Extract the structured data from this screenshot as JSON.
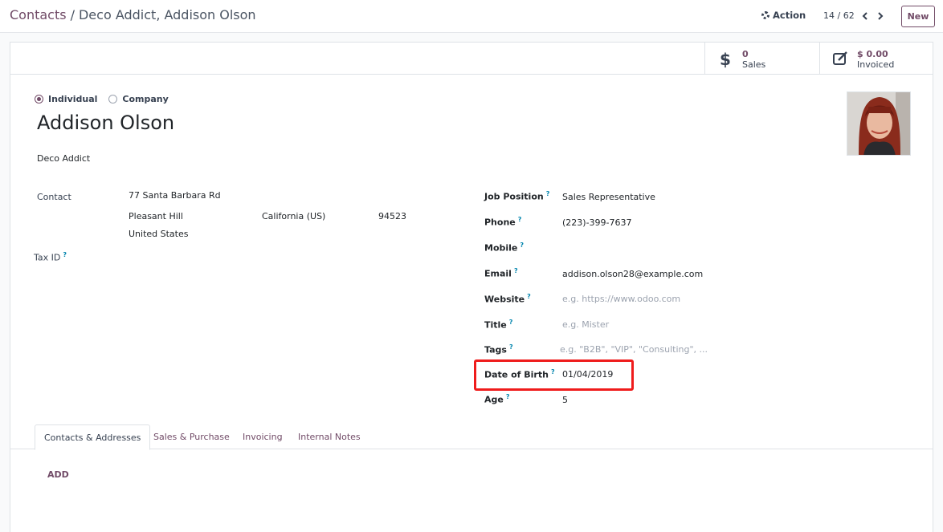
{
  "breadcrumb": {
    "root": "Contacts",
    "separator": "/",
    "current": "Deco Addict, Addison Olson"
  },
  "toolbar": {
    "action_label": "Action",
    "pager": "14 / 62",
    "new_label": "New"
  },
  "stats": [
    {
      "icon": "dollar-icon",
      "value": "0",
      "label": "Sales"
    },
    {
      "icon": "invoice-edit-icon",
      "value": "$ 0.00",
      "label": "Invoiced"
    }
  ],
  "type": {
    "options": [
      "Individual",
      "Company"
    ],
    "selected": "Individual"
  },
  "contact": {
    "name": "Addison Olson",
    "company": "Deco Addict"
  },
  "address": {
    "label": "Contact",
    "street": "77 Santa Barbara Rd",
    "city": "Pleasant Hill",
    "state": "California (US)",
    "zip": "94523",
    "country": "United States"
  },
  "tax": {
    "label": "Tax ID",
    "help": "?"
  },
  "fields": {
    "job_position": {
      "label": "Job Position",
      "value": "Sales Representative"
    },
    "phone": {
      "label": "Phone",
      "value": "(223)-399-7637"
    },
    "mobile": {
      "label": "Mobile",
      "value": ""
    },
    "email": {
      "label": "Email",
      "value": "addison.olson28@example.com"
    },
    "website": {
      "label": "Website",
      "placeholder": "e.g. https://www.odoo.com"
    },
    "title": {
      "label": "Title",
      "placeholder": "e.g. Mister"
    },
    "tags": {
      "label": "Tags",
      "placeholder": "e.g. \"B2B\", \"VIP\", \"Consulting\", ..."
    },
    "dob": {
      "label": "Date of Birth",
      "value": "01/04/2019"
    },
    "age": {
      "label": "Age",
      "value": "5"
    }
  },
  "help_mark": "?",
  "tabs": [
    {
      "label": "Contacts & Addresses",
      "active": true
    },
    {
      "label": "Sales & Purchase",
      "active": false
    },
    {
      "label": "Invoicing",
      "active": false
    },
    {
      "label": "Internal Notes",
      "active": false
    }
  ],
  "add_label": "ADD",
  "colors": {
    "brand": "#714b67",
    "help": "#0184ad",
    "highlight": "#ef1c1c"
  }
}
